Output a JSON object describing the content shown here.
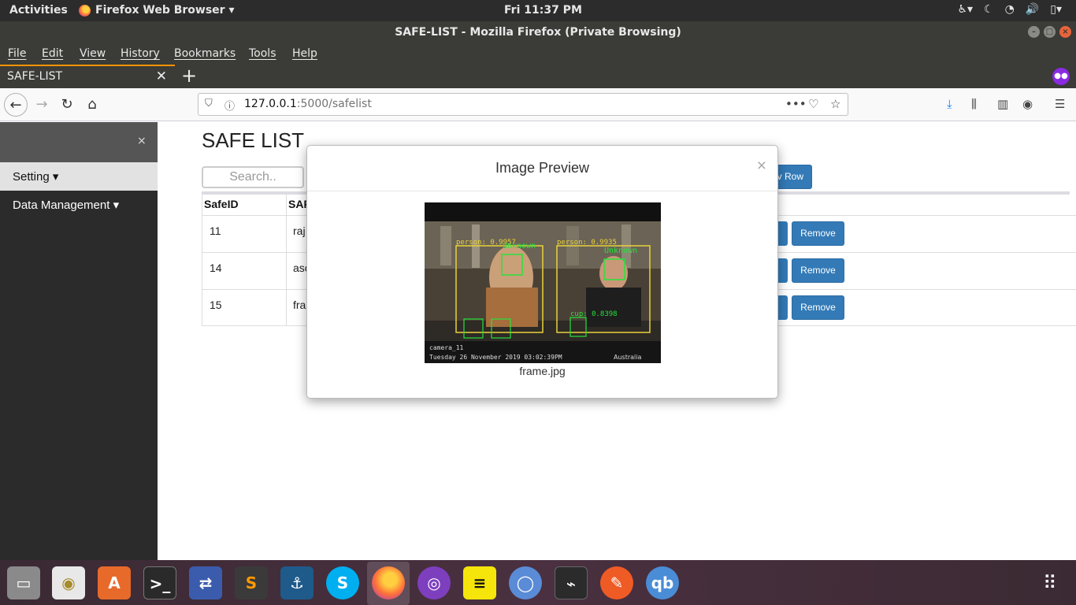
{
  "topbar": {
    "activities": "Activities",
    "app_menu": "Firefox Web Browser ▾",
    "clock": "Fri 11:37 PM"
  },
  "window": {
    "title": "SAFE-LIST - Mozilla Firefox (Private Browsing)"
  },
  "menubar": {
    "file": "File",
    "edit": "Edit",
    "view": "View",
    "history": "History",
    "bookmarks": "Bookmarks",
    "tools": "Tools",
    "help": "Help"
  },
  "tab": {
    "label": "SAFE-LIST",
    "close": "✕",
    "new": "+"
  },
  "urlbar": {
    "host": "127.0.0.1",
    "rest": ":5000/safelist"
  },
  "sidebar": {
    "close": "×",
    "setting": "Setting ▾",
    "data_management": "Data Management ▾"
  },
  "page": {
    "title": "SAFE LIST",
    "search_placeholder": "Search..",
    "new_row_label": "v Row",
    "columns": [
      "SafeID",
      "SAF"
    ],
    "rows": [
      {
        "id": "11",
        "name": "raj",
        "action": "Remove"
      },
      {
        "id": "14",
        "name": "asc",
        "action": "Remove"
      },
      {
        "id": "15",
        "name": "fran",
        "action": "Remove"
      }
    ]
  },
  "modal": {
    "title": "Image Preview",
    "close": "×",
    "filename": "frame.jpg",
    "image_labels": {
      "person1": "person: 0.9957",
      "unknown1": "Unknown",
      "person2": "person: 0.9935",
      "unknown2": "Unknown",
      "cup1": "cup: 0.8398",
      "camera": "camera_11",
      "timestamp": "Tuesday 26 November 2019 03:02:39PM",
      "location": "Australia"
    }
  },
  "dock": {
    "apps": [
      "files-icon",
      "rhythmbox-icon",
      "software-icon",
      "terminal-icon",
      "network-icon",
      "sublime-icon",
      "mysql-workbench-icon",
      "skype-icon",
      "firefox-icon",
      "tor-icon",
      "notes-icon",
      "chromium-icon",
      "system-monitor-icon",
      "postman-icon",
      "qbittorrent-icon"
    ]
  }
}
